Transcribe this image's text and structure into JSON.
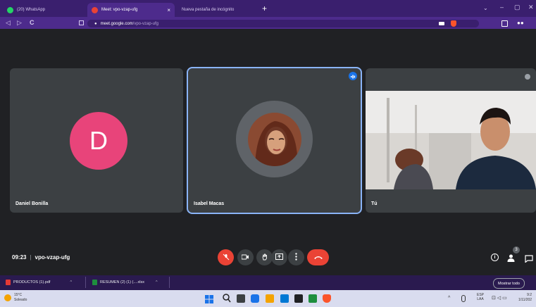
{
  "browser": {
    "tabs": [
      {
        "label": "(20) WhatsApp",
        "color": "#25d366"
      },
      {
        "label": "Meet: vpo-vzap-ufg",
        "color": "#ea4335"
      },
      {
        "label": "Nueva pestaña de incógnito",
        "color": "#9aa0a6"
      }
    ],
    "close_glyph": "×",
    "new_tab_glyph": "+",
    "url_host": "meet.google.com",
    "url_path": "/vpo-vzap-ufg",
    "nav": {
      "back": "◁",
      "forward": "▷",
      "reload": "C"
    },
    "window_controls": {
      "minimize": "–",
      "maximize": "▢",
      "close": "✕",
      "tab_search": "⌄"
    }
  },
  "meet": {
    "participants": [
      {
        "name": "Daniel Bonilla",
        "initial": "D",
        "avatar_color": "#e8447a"
      },
      {
        "name": "Isabel Macas",
        "speaking": true
      },
      {
        "name": "Tú"
      }
    ],
    "time": "09:23",
    "separator": "|",
    "meeting_code": "vpo-vzap-ufg",
    "participant_count": "3"
  },
  "downloads": {
    "items": [
      {
        "label": "PRODUCTOS (1).pdf",
        "icon_color": "#e53935"
      },
      {
        "label": "RESUMEN (2) (1) (....xlsx",
        "icon_color": "#1e8e3e"
      }
    ],
    "chevron": "^",
    "show_all": "Mostrar todo"
  },
  "taskbar": {
    "weather_temp": "15°C",
    "weather_desc": "Soleado",
    "lang_top": "ESP",
    "lang_bottom": "LAA",
    "clock_time": "9:2",
    "clock_date": "1/11/202"
  },
  "colors": {
    "brand_purple": "#4d2b8c",
    "meet_bg": "#202124",
    "tile": "#3c4043",
    "red": "#ea4335",
    "accent_blue": "#8ab4f8"
  }
}
